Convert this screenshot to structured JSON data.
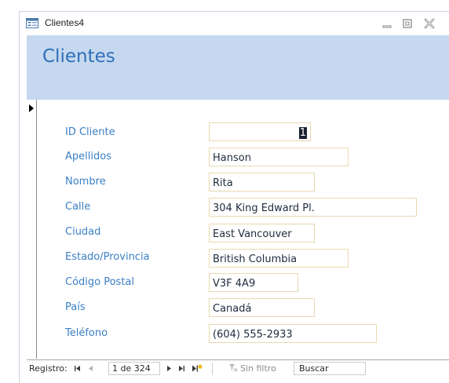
{
  "window": {
    "title": "Clientes4",
    "controls": [
      "minimize",
      "maximize",
      "close"
    ]
  },
  "form": {
    "title": "Clientes",
    "fields": [
      {
        "label": "ID Cliente",
        "value": "1"
      },
      {
        "label": "Apellidos",
        "value": "Hanson"
      },
      {
        "label": "Nombre",
        "value": "Rita"
      },
      {
        "label": "Calle",
        "value": "304 King Edward Pl."
      },
      {
        "label": "Ciudad",
        "value": "East Vancouver"
      },
      {
        "label": "Estado/Provincia",
        "value": "British Columbia"
      },
      {
        "label": "Código Postal",
        "value": "V3F 4A9"
      },
      {
        "label": "País",
        "value": "Canadá"
      },
      {
        "label": "Teléfono",
        "value": "(604) 555-2933"
      }
    ]
  },
  "navigation": {
    "record_label": "Registro:",
    "first_icon": "first-record-icon",
    "prev_icon": "previous-record-icon",
    "record_position": "1 de 324",
    "next_icon": "next-record-icon",
    "last_icon": "last-record-icon",
    "new_icon": "new-record-icon",
    "filter_label": "Sin filtro",
    "search_label": "Buscar"
  },
  "colors": {
    "header_bg": "#c5d8ef",
    "title_color": "#2f6fb7",
    "label_color": "#3b7fc4",
    "field_border": "#e8d9b0"
  }
}
